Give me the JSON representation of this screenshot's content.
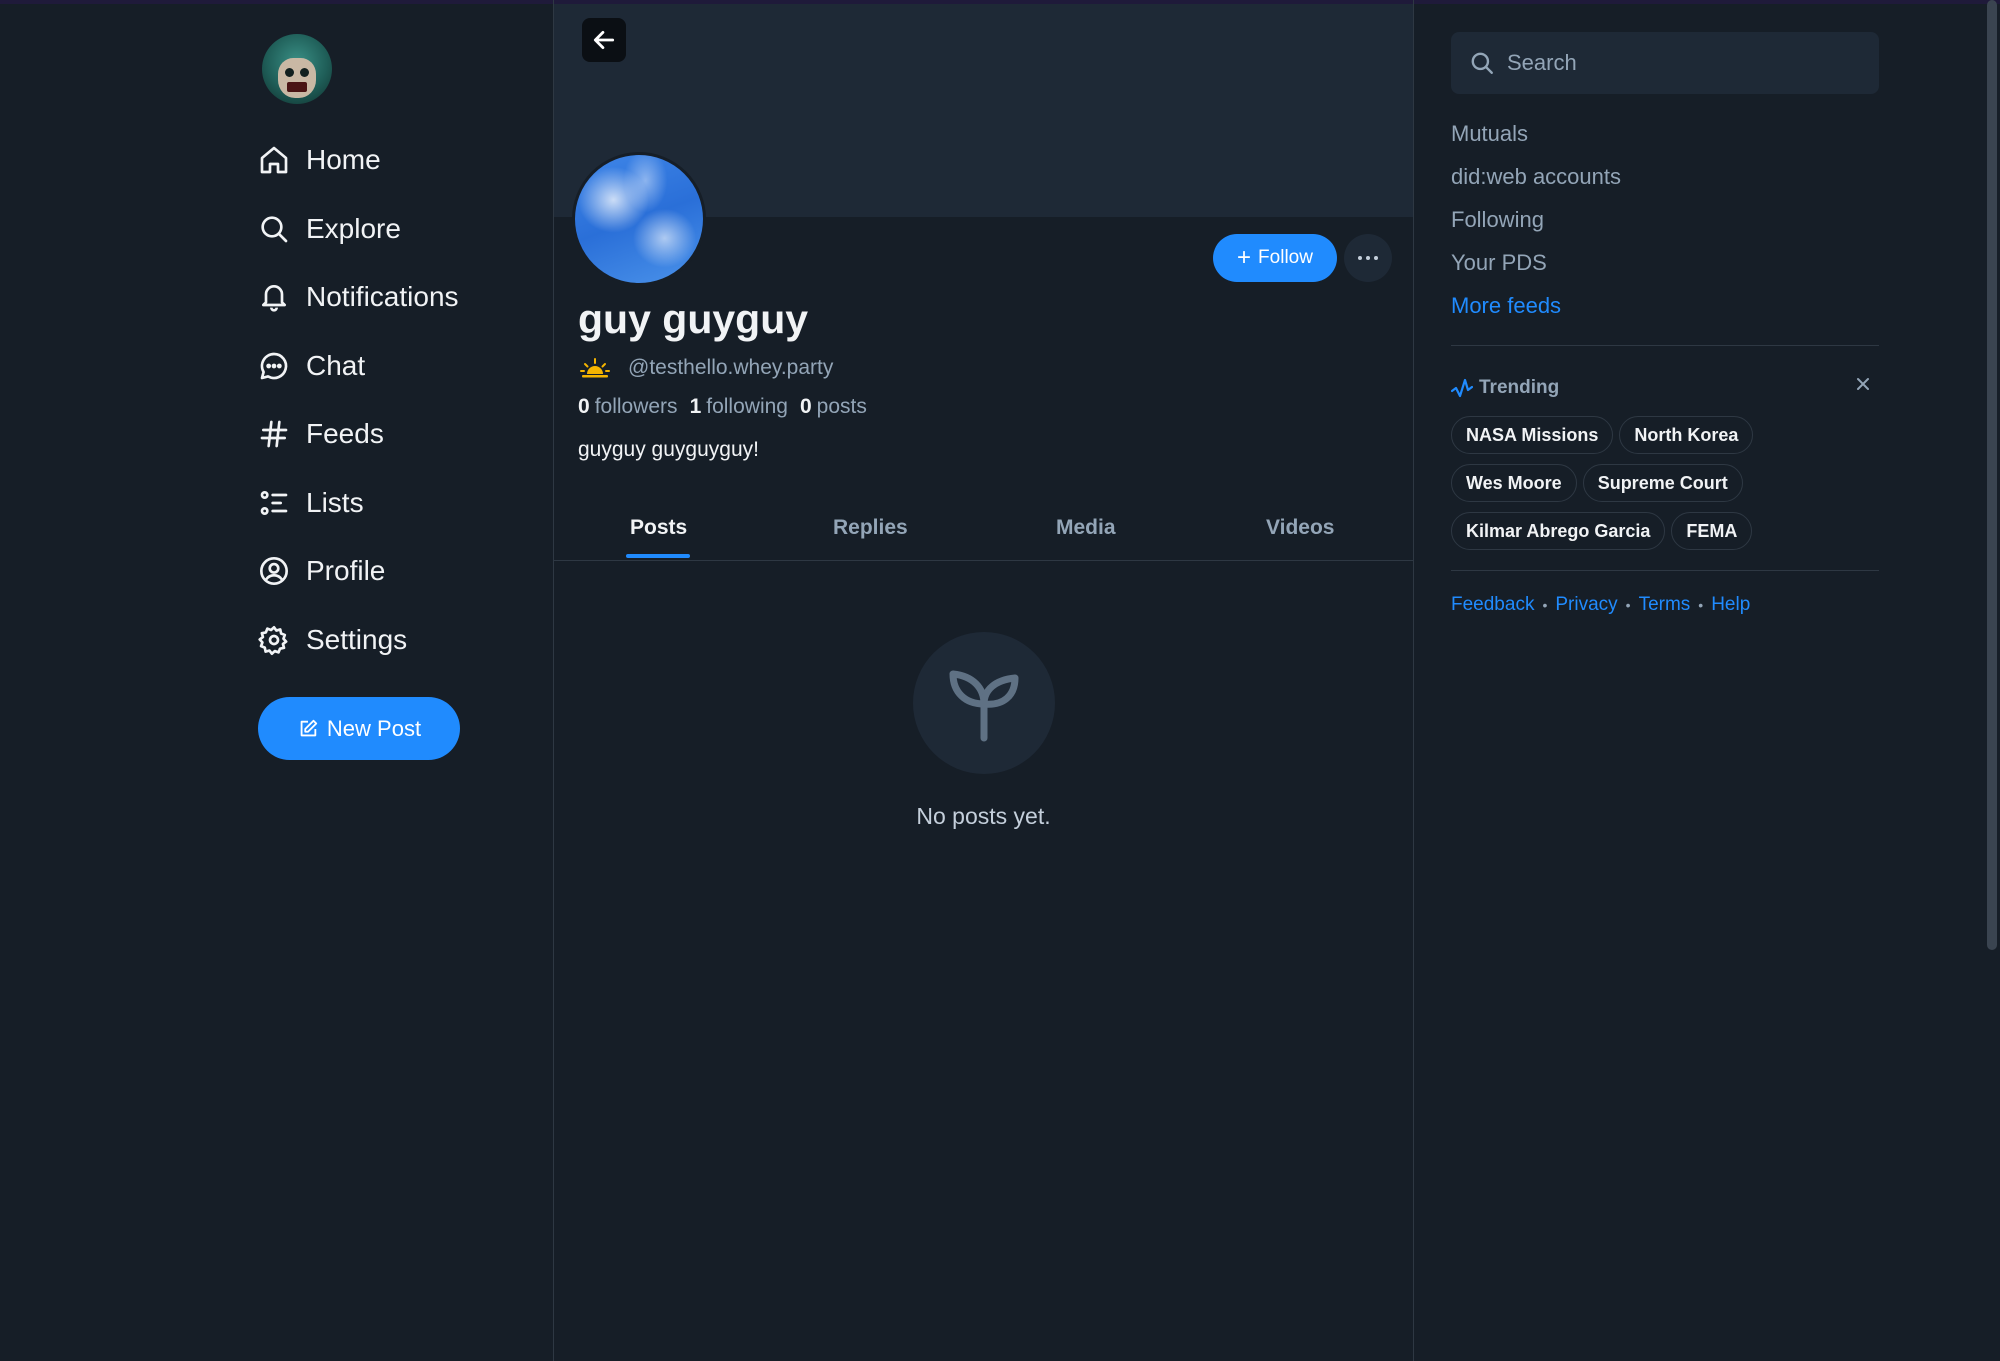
{
  "nav": {
    "items": [
      {
        "label": "Home",
        "icon": "home-icon"
      },
      {
        "label": "Explore",
        "icon": "search-icon"
      },
      {
        "label": "Notifications",
        "icon": "bell-icon"
      },
      {
        "label": "Chat",
        "icon": "chat-icon"
      },
      {
        "label": "Feeds",
        "icon": "hash-icon"
      },
      {
        "label": "Lists",
        "icon": "list-icon"
      },
      {
        "label": "Profile",
        "icon": "profile-icon"
      },
      {
        "label": "Settings",
        "icon": "gear-icon"
      }
    ],
    "new_post_label": "New Post"
  },
  "profile": {
    "display_name": "guy guyguy",
    "handle": "@testhello.whey.party",
    "followers_count": "0",
    "followers_label": "followers",
    "following_count": "1",
    "following_label": "following",
    "posts_count": "0",
    "posts_label": "posts",
    "bio": "guyguy guyguyguy!",
    "follow_label": "Follow",
    "tabs": [
      {
        "label": "Posts",
        "active": true
      },
      {
        "label": "Replies",
        "active": false
      },
      {
        "label": "Media",
        "active": false
      },
      {
        "label": "Videos",
        "active": false
      }
    ],
    "empty_text": "No posts yet."
  },
  "sidebar": {
    "search_placeholder": "Search",
    "feeds": [
      "Mutuals",
      "did:web accounts",
      "Following",
      "Your PDS"
    ],
    "more_feeds_label": "More feeds",
    "trending_label": "Trending",
    "trending_rows": [
      [
        "NASA Missions",
        "North Korea"
      ],
      [
        "Wes Moore",
        "Supreme Court"
      ],
      [
        "Kilmar Abrego Garcia",
        "FEMA"
      ]
    ],
    "footer": [
      "Feedback",
      "Privacy",
      "Terms",
      "Help"
    ]
  },
  "colors": {
    "background": "#161e27",
    "accent": "#208bfe",
    "muted_text": "#93a5b7",
    "surface": "#1e2936"
  }
}
